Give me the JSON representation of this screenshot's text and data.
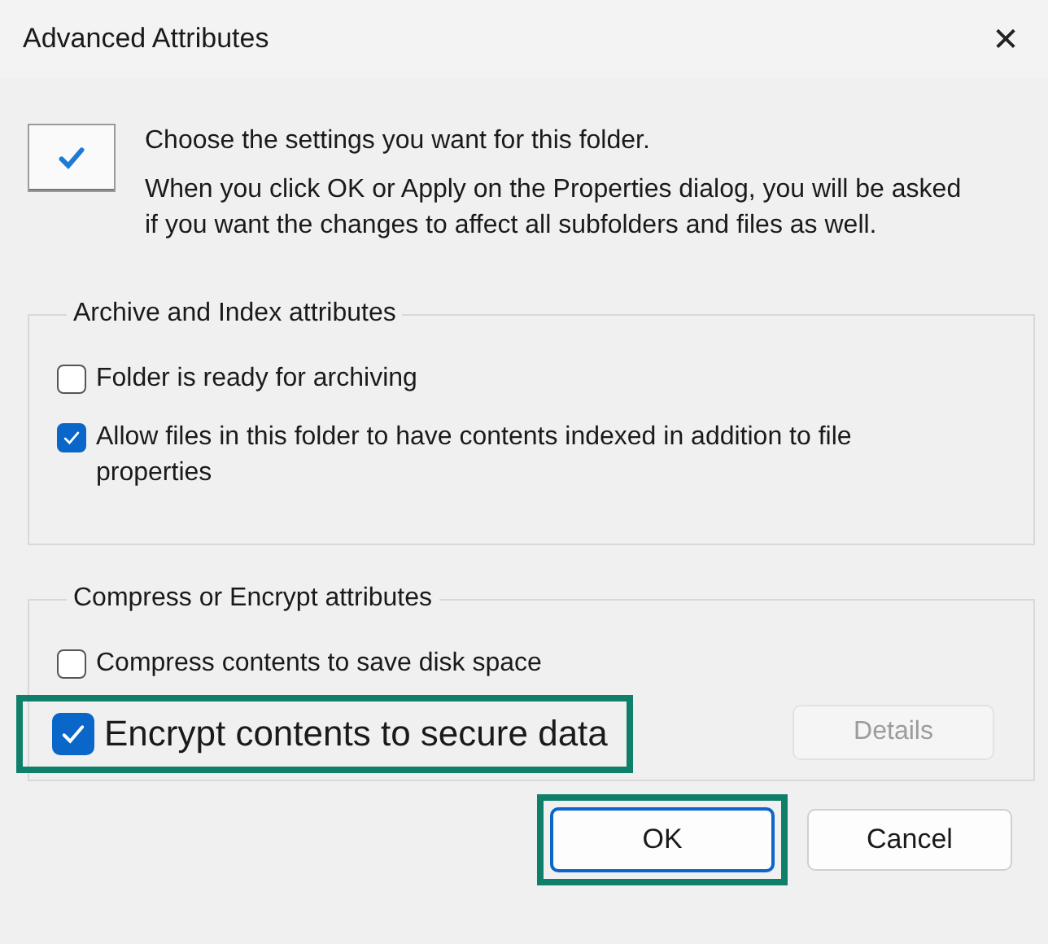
{
  "window": {
    "title": "Advanced Attributes",
    "close": "✕"
  },
  "intro": {
    "heading": "Choose the settings you want for this folder.",
    "text": "When you click OK or Apply on the Properties dialog, you will be asked if you want the changes to affect all subfolders and files as well."
  },
  "groups": [
    {
      "title": "Archive and Index attributes",
      "options": [
        {
          "label": "Folder is ready for archiving",
          "checked": false,
          "highlighted": false
        },
        {
          "label": "Allow files in this folder to have contents indexed in addition to file properties",
          "checked": true,
          "highlighted": false
        }
      ]
    },
    {
      "title": "Compress or Encrypt attributes",
      "options": [
        {
          "label": "Compress contents to save disk space",
          "checked": false,
          "highlighted": false
        },
        {
          "label": "Encrypt contents to secure data",
          "checked": true,
          "highlighted": true
        }
      ],
      "button": {
        "label": "Details",
        "disabled": true
      }
    }
  ],
  "buttons": [
    {
      "label": "OK",
      "default": true,
      "highlighted": true
    },
    {
      "label": "Cancel",
      "default": false,
      "highlighted": false
    }
  ]
}
